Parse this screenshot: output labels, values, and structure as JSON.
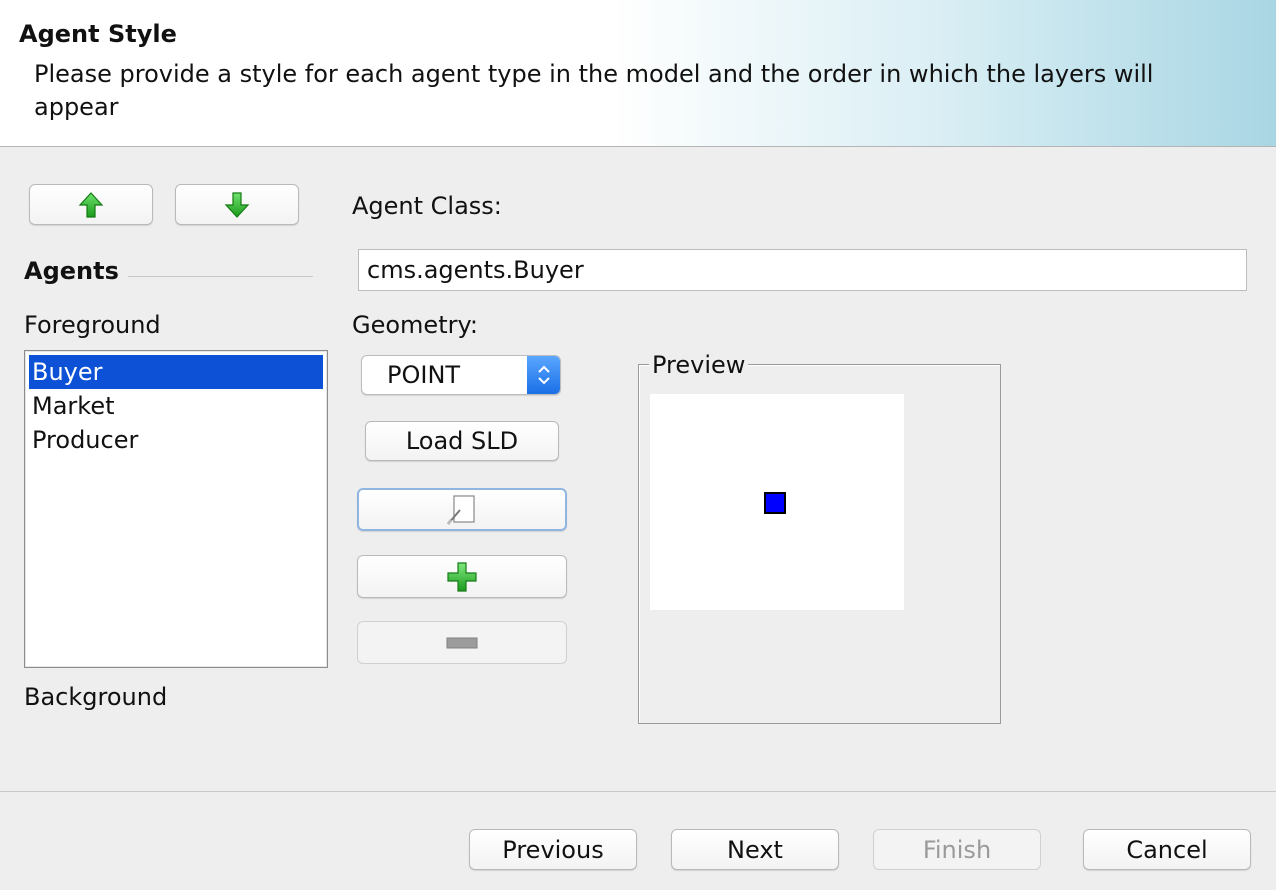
{
  "header": {
    "title": "Agent Style",
    "description": "Please provide a style for each agent type in the model and the order in which the layers will appear"
  },
  "layer_buttons": {
    "up_icon": "green-up-arrow-icon",
    "down_icon": "green-down-arrow-icon"
  },
  "agents": {
    "heading": "Agents",
    "foreground_label": "Foreground",
    "background_label": "Background",
    "items": [
      "Buyer",
      "Market",
      "Producer"
    ],
    "selected": "Buyer",
    "selection_color": "#0d52d6"
  },
  "agent_class": {
    "label": "Agent Class:",
    "value": "cms.agents.Buyer"
  },
  "geometry": {
    "label": "Geometry:",
    "selected": "POINT"
  },
  "style_buttons": {
    "load_sld": "Load SLD",
    "edit_icon": "edit-style-icon",
    "add_icon": "green-plus-icon",
    "remove_icon": "minus-icon"
  },
  "preview": {
    "title": "Preview",
    "point_color": "#0000ff"
  },
  "footer": {
    "previous": "Previous",
    "next": "Next",
    "finish": "Finish",
    "cancel": "Cancel"
  }
}
